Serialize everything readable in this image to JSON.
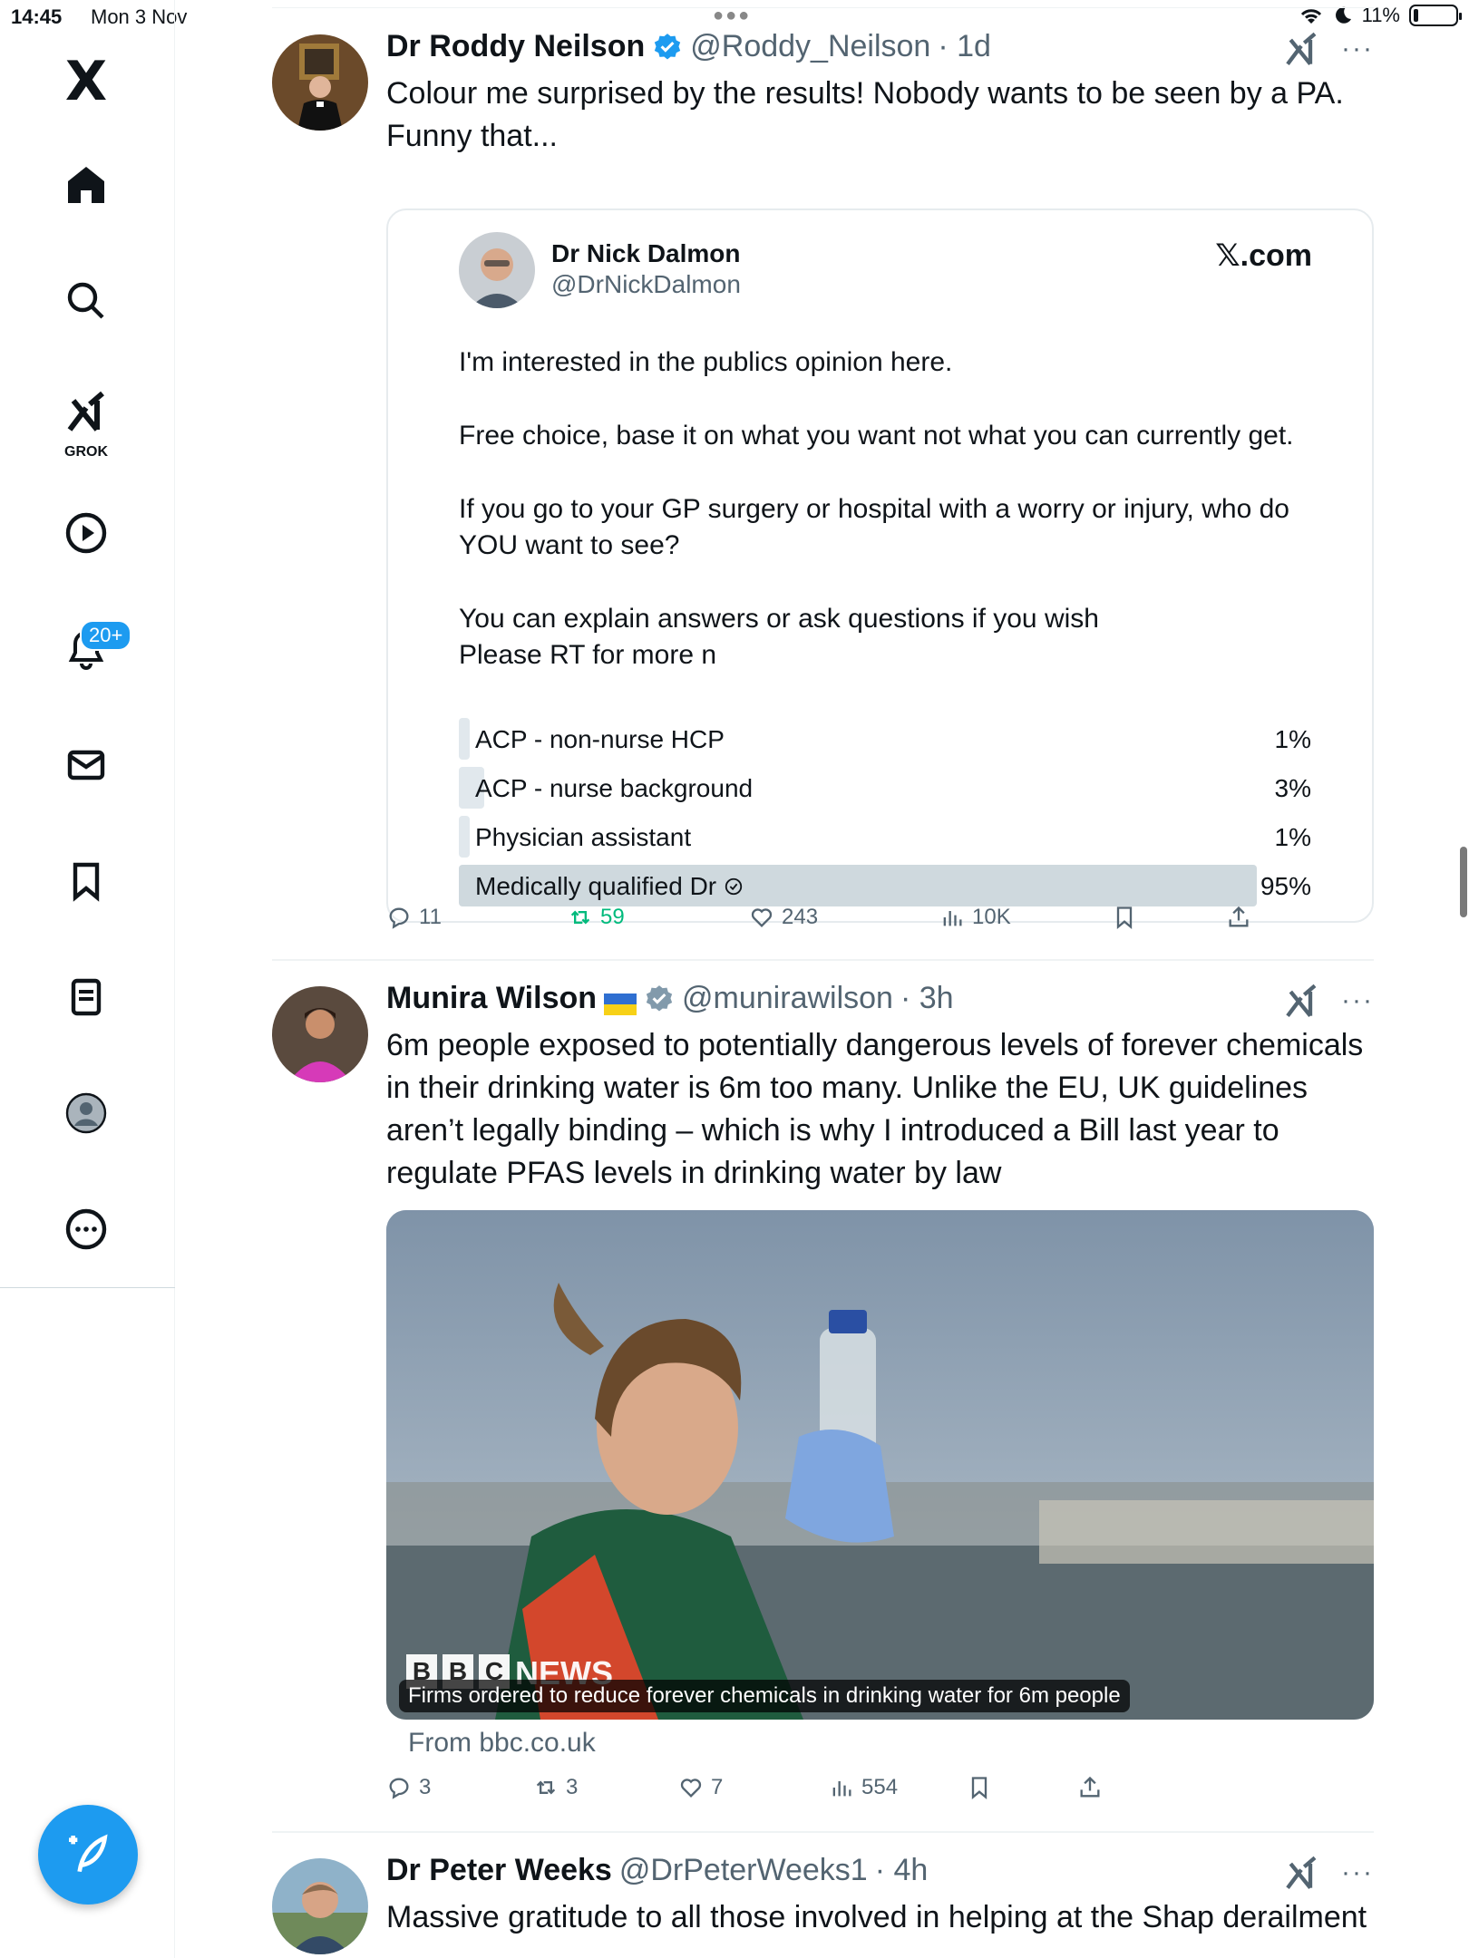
{
  "status_bar": {
    "time": "14:45",
    "date": "Mon 3 Nov",
    "battery": "11%"
  },
  "sidebar": {
    "logo": "X",
    "items": [
      {
        "name": "home",
        "icon": "home-icon"
      },
      {
        "name": "search",
        "icon": "search-icon"
      },
      {
        "name": "grok",
        "icon": "grok-icon",
        "label": "GROK"
      },
      {
        "name": "video",
        "icon": "play-icon"
      },
      {
        "name": "notifications",
        "icon": "bell-icon",
        "badge": "20+"
      },
      {
        "name": "messages",
        "icon": "mail-icon"
      },
      {
        "name": "bookmarks",
        "icon": "bookmark-icon"
      },
      {
        "name": "lists",
        "icon": "list-icon"
      },
      {
        "name": "profile",
        "icon": "profile-icon"
      },
      {
        "name": "more",
        "icon": "more-icon"
      }
    ],
    "compose_icon": "compose-icon"
  },
  "tweets": [
    {
      "name": "Dr Roddy Neilson",
      "handle": "@Roddy_Neilson",
      "time": "· 1d",
      "text": "Colour me surprised by the results! Nobody wants to be seen by a PA. Funny that...",
      "quote": {
        "name": "Dr Nick Dalmon",
        "handle": "@DrNickDalmon",
        "brand": "𝕏.com",
        "paragraphs": [
          "I'm interested in the publics opinion here.",
          "Free choice, base it on what you want not what you can currently get.",
          "If you go to your GP surgery or hospital with a worry or injury, who do YOU want to see?",
          "You can explain answers or ask questions if you wish",
          "Please RT for more n"
        ],
        "poll": [
          {
            "label": "ACP - non-nurse HCP",
            "pct": "1%",
            "value": 1
          },
          {
            "label": "ACP - nurse background",
            "pct": "3%",
            "value": 3
          },
          {
            "label": "Physician assistant",
            "pct": "1%",
            "value": 1
          },
          {
            "label": "Medically qualified Dr",
            "pct": "95%",
            "value": 95,
            "winner": true
          }
        ]
      },
      "stats": {
        "replies": "11",
        "reposts": "59",
        "likes": "243",
        "views": "10K"
      }
    },
    {
      "name": "Munira Wilson",
      "flag": "🇺🇦",
      "handle": "@munirawilson",
      "time": "· 3h",
      "text": "6m people exposed to potentially dangerous levels of forever chemicals in their drinking water is 6m too many. Unlike the EU, UK guidelines aren’t legally binding – which is why I introduced a Bill last year to regulate PFAS levels in drinking water by law",
      "card": {
        "logo": "NEWS",
        "caption": "Firms ordered to reduce forever chemicals in drinking water for 6m people",
        "source": "From bbc.co.uk"
      },
      "stats": {
        "replies": "3",
        "reposts": "3",
        "likes": "7",
        "views": "554"
      }
    },
    {
      "name": "Dr Peter Weeks",
      "handle": "@DrPeterWeeks1",
      "time": "· 4h",
      "text": "Massive gratitude to all those involved in helping at the Shap derailment"
    }
  ],
  "colors": {
    "accent": "#1d9bf0",
    "repost_green": "#00ba7c",
    "muted": "#536471"
  }
}
